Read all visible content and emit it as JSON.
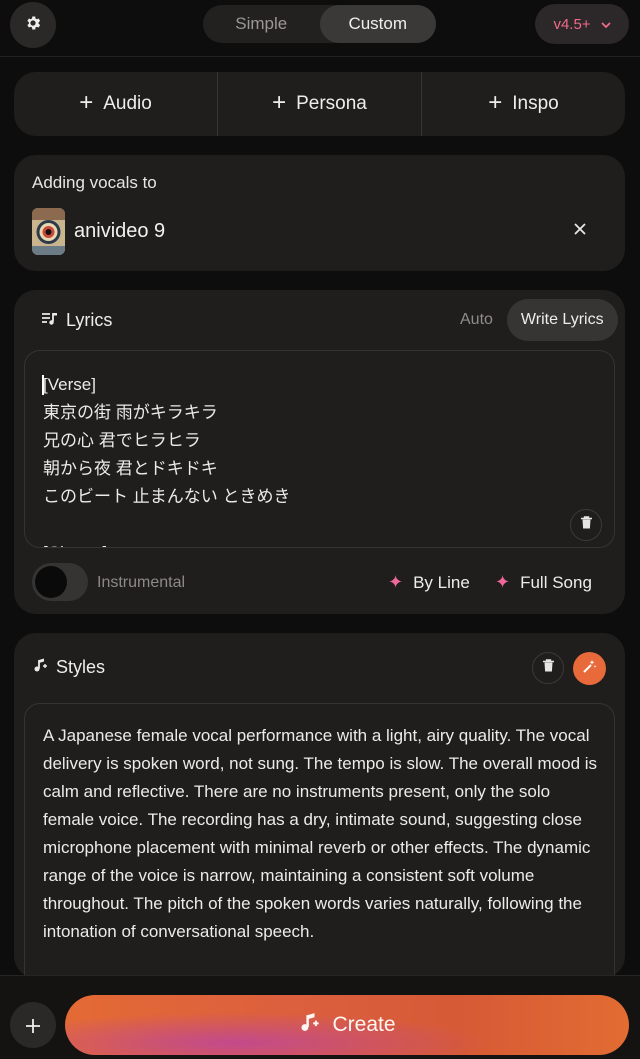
{
  "header": {
    "settings_icon": "gear-icon",
    "mode_tabs": [
      {
        "label": "Simple",
        "active": false
      },
      {
        "label": "Custom",
        "active": true
      }
    ],
    "version": {
      "label": "v4.5+",
      "color": "#ef6b8a",
      "icon": "chevron-down-icon"
    }
  },
  "add_row": [
    {
      "label": "Audio",
      "icon": "plus-icon"
    },
    {
      "label": "Persona",
      "icon": "plus-icon"
    },
    {
      "label": "Inspo",
      "icon": "plus-icon"
    }
  ],
  "vocals": {
    "title": "Adding vocals to",
    "song_name": "anivideo 9"
  },
  "lyrics": {
    "title": "Lyrics",
    "tabs": [
      {
        "label": "Auto",
        "active": false
      },
      {
        "label": "Write Lyrics",
        "active": true
      }
    ],
    "text": "[Verse]\n東京の街 雨がキラキラ\n兄の心 君でヒラヒラ\n朝から夜 君とドキドキ\nこのビート 止まんない ときめき\n\n[Chorus]",
    "instrumental_label": "Instrumental",
    "instrumental_on": false,
    "by_line_label": "By Line",
    "full_song_label": "Full Song"
  },
  "styles": {
    "title": "Styles",
    "text": "A Japanese female vocal performance with a light, airy quality. The vocal delivery is spoken word, not sung. The tempo is slow. The overall mood is calm and reflective. There are no instruments present, only the solo female voice. The recording has a dry, intimate sound, suggesting close microphone placement with minimal reverb or other effects. The dynamic range of the voice is narrow, maintaining a consistent soft volume throughout. The pitch of the spoken words varies naturally, following the intonation of conversational speech."
  },
  "bottom": {
    "create_label": "Create",
    "accent": "#e46a35"
  }
}
